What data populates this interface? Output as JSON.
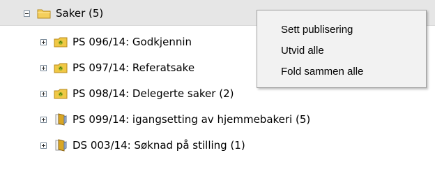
{
  "tree": {
    "root": {
      "label": "Saker (5)",
      "expanded": true,
      "icon": "folder-icon"
    },
    "items": [
      {
        "label": "PS 096/14: Godkjennin",
        "icon": "case-folder-icon"
      },
      {
        "label": "PS 097/14: Referatsake",
        "icon": "case-folder-icon"
      },
      {
        "label": "PS 098/14: Delegerte saker (2)",
        "icon": "case-folder-icon"
      },
      {
        "label": "PS 099/14: igangsetting av hjemmebakeri (5)",
        "icon": "document-folder-icon"
      },
      {
        "label": "DS 003/14: Søknad på stilling (1)",
        "icon": "document-folder-icon"
      }
    ]
  },
  "context_menu": {
    "items": [
      {
        "label": "Sett publisering"
      },
      {
        "label": "Utvid alle"
      },
      {
        "label": "Fold sammen alle"
      }
    ]
  }
}
